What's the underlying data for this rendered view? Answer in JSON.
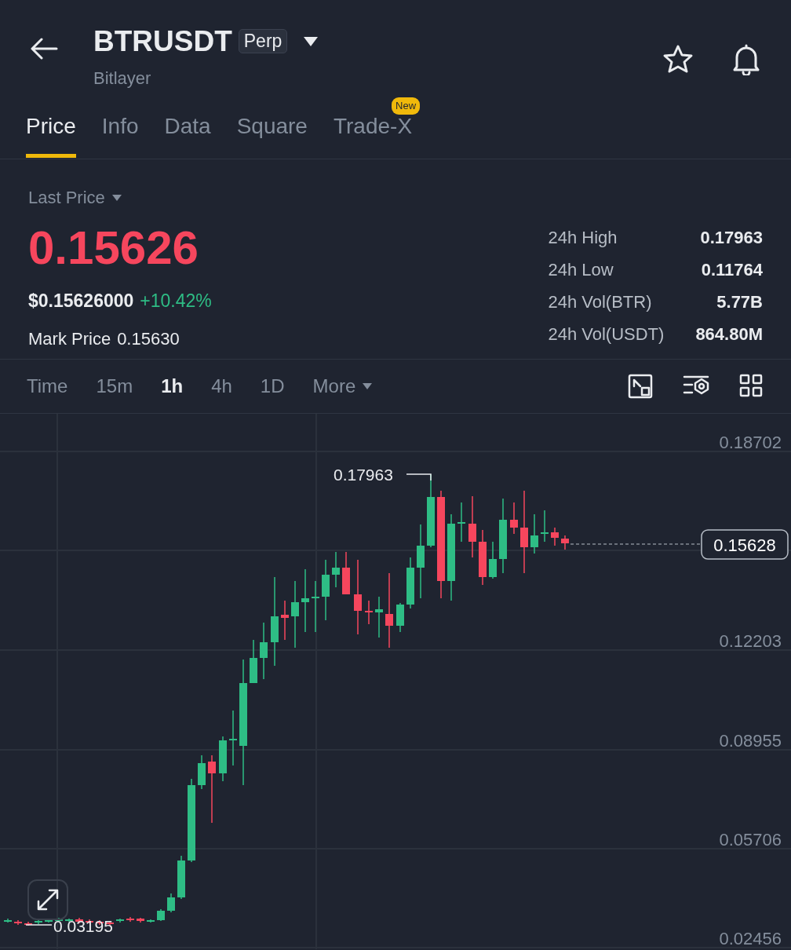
{
  "header": {
    "title": "BTRUSDT",
    "badge": "Perp",
    "subtitle": "Bitlayer"
  },
  "tabs": [
    {
      "label": "Price",
      "selected": true
    },
    {
      "label": "Info",
      "selected": false
    },
    {
      "label": "Data",
      "selected": false
    },
    {
      "label": "Square",
      "selected": false
    },
    {
      "label": "Trade-X",
      "selected": false,
      "badge": "New"
    }
  ],
  "price": {
    "selector": "Last Price",
    "last_price": "0.15626",
    "usd_price": "$0.15626000",
    "change": "+10.42%",
    "mark_label": "Mark Price",
    "mark_price": "0.15630"
  },
  "stats": [
    {
      "label": "24h High",
      "value": "0.17963"
    },
    {
      "label": "24h Low",
      "value": "0.11764"
    },
    {
      "label": "24h Vol(BTR)",
      "value": "5.77B"
    },
    {
      "label": "24h Vol(USDT)",
      "value": "864.80M"
    }
  ],
  "intervals": [
    {
      "label": "Time",
      "selected": false,
      "kind": "plain"
    },
    {
      "label": "15m",
      "selected": false,
      "kind": "plain"
    },
    {
      "label": "1h",
      "selected": true,
      "kind": "plain"
    },
    {
      "label": "4h",
      "selected": false,
      "kind": "plain"
    },
    {
      "label": "1D",
      "selected": false,
      "kind": "plain"
    },
    {
      "label": "More",
      "selected": false,
      "kind": "dropdown"
    }
  ],
  "chart": {
    "y_axis_labels": [
      "0.18702",
      "0.12203",
      "0.08955",
      "0.05706",
      "0.02456"
    ],
    "high_label": "0.17963",
    "low_label": "0.03195",
    "current_price": "0.15628"
  }
}
